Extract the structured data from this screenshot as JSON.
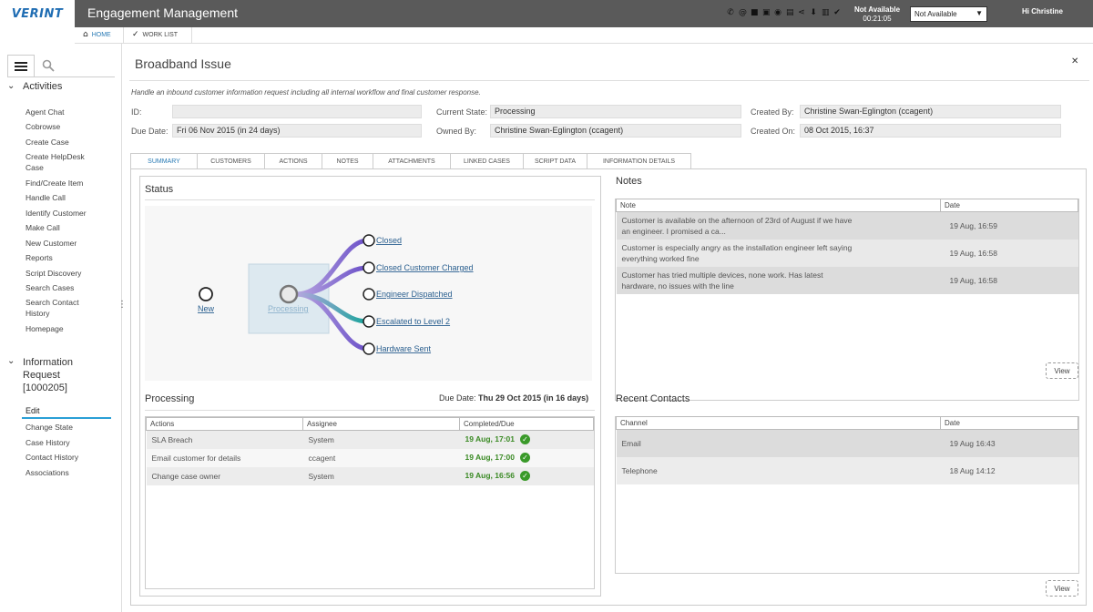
{
  "header": {
    "logo": "VERINT",
    "app_title": "Engagement Management",
    "status_line1": "Not Available",
    "status_line2": "00:21:05",
    "status_select": "Not Available",
    "greeting": "Hi Christine"
  },
  "breadcrumbs": {
    "home": "HOME",
    "worklist": "WORK LIST"
  },
  "sidebar": {
    "activities_title": "Activities",
    "activities": [
      "Agent Chat",
      "Cobrowse",
      "Create Case",
      "Create HelpDesk Case",
      "Find/Create Item",
      "Handle Call",
      "Identify Customer",
      "Make Call",
      "New Customer",
      "Reports",
      "Script Discovery",
      "Search Cases",
      "Search Contact History",
      "Homepage"
    ],
    "request_title": "Information Request [1000205]",
    "request_active": "Edit",
    "request_items": [
      "Change State",
      "Case History",
      "Contact History",
      "Associations"
    ]
  },
  "case": {
    "title": "Broadband Issue",
    "description": "Handle an inbound customer information request including all internal workflow and final customer response.",
    "fields": {
      "id_label": "ID:",
      "id_value": "",
      "current_state_label": "Current State:",
      "current_state_value": "Processing",
      "created_by_label": "Created By:",
      "created_by_value": "Christine Swan-Eglington (ccagent)",
      "due_date_label": "Due Date:",
      "due_date_value": "Fri 06 Nov 2015 (in 24 days)",
      "owned_by_label": "Owned By:",
      "owned_by_value": "Christine Swan-Eglington (ccagent)",
      "created_on_label": "Created On:",
      "created_on_value": "08 Oct 2015, 16:37"
    },
    "tabs": [
      "SUMMARY",
      "CUSTOMERS",
      "ACTIONS",
      "NOTES",
      "ATTACHMENTS",
      "LINKED CASES",
      "SCRIPT DATA",
      "INFORMATION DETAILS"
    ]
  },
  "status": {
    "title": "Status",
    "start_node": "New",
    "current_node": "Processing",
    "outcomes": [
      "Closed",
      "Closed Customer Charged",
      "Engineer Dispatched",
      "Escalated to Level 2",
      "Hardware Sent"
    ]
  },
  "processing": {
    "title": "Processing",
    "due_label": "Due Date:",
    "due_value": "Thu 29 Oct 2015 (in 16 days)",
    "columns": [
      "Actions",
      "Assignee",
      "Completed/Due"
    ],
    "rows": [
      {
        "action": "SLA Breach",
        "assignee": "System",
        "completed": "19 Aug, 17:01"
      },
      {
        "action": "Email customer for details",
        "assignee": "ccagent",
        "completed": "19 Aug, 17:00"
      },
      {
        "action": "Change case owner",
        "assignee": "System",
        "completed": "19 Aug, 16:56"
      }
    ]
  },
  "notes": {
    "title": "Notes",
    "columns": [
      "Note",
      "Date"
    ],
    "rows": [
      {
        "note": "Customer is available on the afternoon of 23rd of August if we have an engineer. I promised a ca...",
        "date": "19 Aug, 16:59"
      },
      {
        "note": "Customer is especially angry as the installation engineer left saying everything worked fine",
        "date": "19 Aug, 16:58"
      },
      {
        "note": "Customer has tried multiple devices, none work. Has latest hardware, no issues with the line",
        "date": "19 Aug, 16:58"
      }
    ],
    "view_label": "View"
  },
  "contacts": {
    "title": "Recent Contacts",
    "columns": [
      "Channel",
      "Date"
    ],
    "rows": [
      {
        "channel": "Email",
        "date": "19 Aug 16:43"
      },
      {
        "channel": "Telephone",
        "date": "18 Aug 14:12"
      }
    ],
    "view_label": "View"
  },
  "colors": {
    "accent": "#2a9fd6",
    "topbar": "#5a5a5a",
    "success": "#3a8a24"
  }
}
